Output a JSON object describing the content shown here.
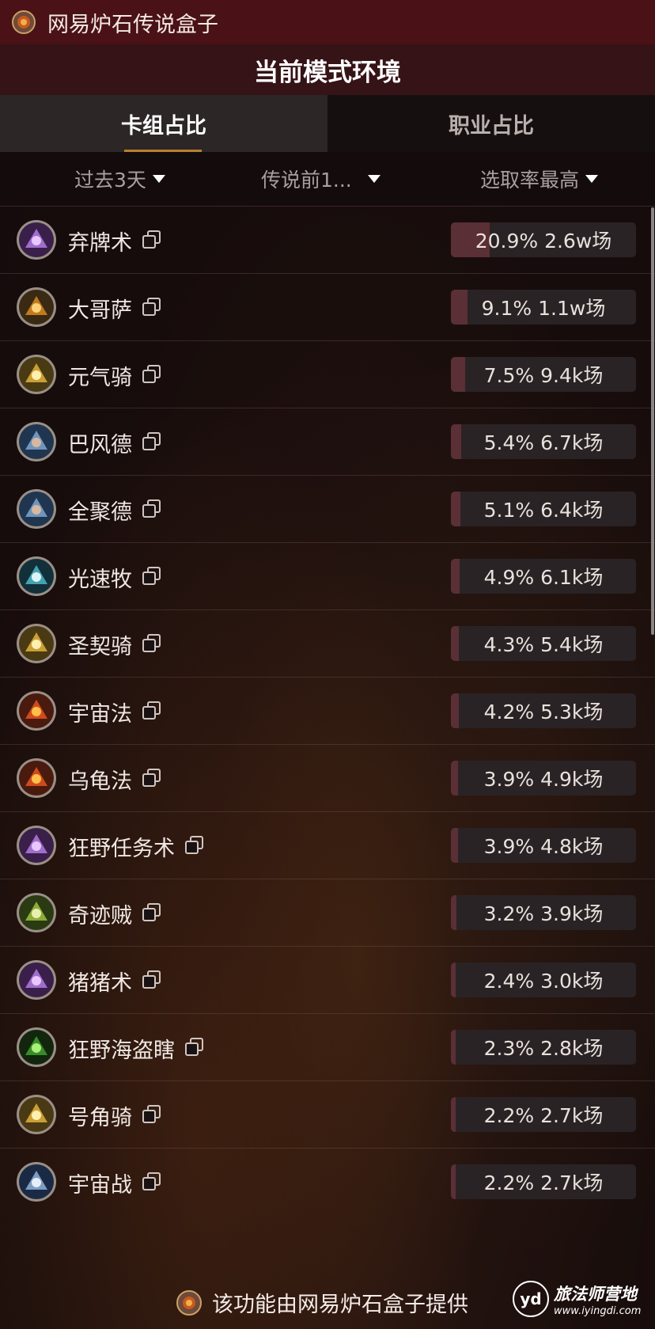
{
  "app": {
    "title": "网易炉石传说盒子"
  },
  "header": {
    "title": "当前模式环境"
  },
  "tabs": [
    {
      "label": "卡组占比",
      "active": true
    },
    {
      "label": "职业占比",
      "active": false
    }
  ],
  "filters": [
    {
      "label": "过去3天"
    },
    {
      "label": "传说前1..."
    },
    {
      "label": "选取率最高"
    }
  ],
  "rows": [
    {
      "name": "弃牌术",
      "pct": 20.9,
      "stat": "20.9% 2.6w场",
      "icon": "warlock-icon"
    },
    {
      "name": "大哥萨",
      "pct": 9.1,
      "stat": "9.1% 1.1w场",
      "icon": "shaman-icon"
    },
    {
      "name": "元气骑",
      "pct": 7.5,
      "stat": "7.5% 9.4k场",
      "icon": "paladin-icon"
    },
    {
      "name": "巴风德",
      "pct": 5.4,
      "stat": "5.4% 6.7k场",
      "icon": "druid-icon"
    },
    {
      "name": "全聚德",
      "pct": 5.1,
      "stat": "5.1% 6.4k场",
      "icon": "druid-icon"
    },
    {
      "name": "光速牧",
      "pct": 4.9,
      "stat": "4.9% 6.1k场",
      "icon": "priest-icon"
    },
    {
      "name": "圣契骑",
      "pct": 4.3,
      "stat": "4.3% 5.4k场",
      "icon": "paladin-icon"
    },
    {
      "name": "宇宙法",
      "pct": 4.2,
      "stat": "4.2% 5.3k场",
      "icon": "mage-icon"
    },
    {
      "name": "乌龟法",
      "pct": 3.9,
      "stat": "3.9% 4.9k场",
      "icon": "mage-icon"
    },
    {
      "name": "狂野任务术",
      "pct": 3.9,
      "stat": "3.9% 4.8k场",
      "icon": "warlock-icon"
    },
    {
      "name": "奇迹贼",
      "pct": 3.2,
      "stat": "3.2% 3.9k场",
      "icon": "rogue-icon"
    },
    {
      "name": "猪猪术",
      "pct": 2.4,
      "stat": "2.4% 3.0k场",
      "icon": "warlock-icon"
    },
    {
      "name": "狂野海盗瞎",
      "pct": 2.3,
      "stat": "2.3% 2.8k场",
      "icon": "demon-hunter-icon"
    },
    {
      "name": "号角骑",
      "pct": 2.2,
      "stat": "2.2% 2.7k场",
      "icon": "paladin-icon"
    },
    {
      "name": "宇宙战",
      "pct": 2.2,
      "stat": "2.2% 2.7k场",
      "icon": "warrior-icon"
    }
  ],
  "footer": {
    "credit": "该功能由网易炉石盒子提供"
  },
  "watermark": {
    "badge": "yd",
    "name": "旅法师营地",
    "url": "www.iyingdi.com"
  },
  "colors": {
    "titlebar": "#4a1216",
    "header": "#351317",
    "bar_fill": "#5a2f35",
    "tab_underline": "#b8812f"
  }
}
